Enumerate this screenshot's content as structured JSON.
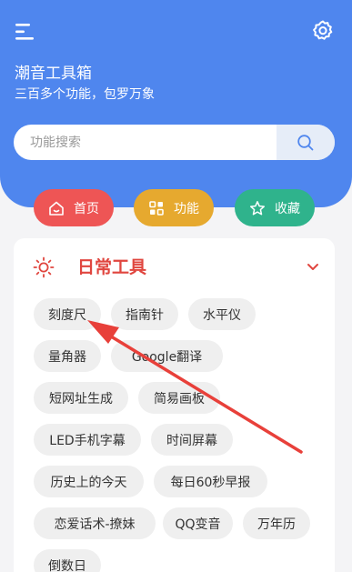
{
  "header": {
    "title": "潮音工具箱",
    "subtitle": "三百多个功能，包罗万象",
    "menu_icon": "menu-icon",
    "settings_icon": "gear-icon",
    "background": "#4f86ee"
  },
  "search": {
    "placeholder": "功能搜索",
    "button_icon": "search-icon"
  },
  "nav": {
    "home": {
      "label": "首页",
      "icon": "home-icon",
      "color": "#ee5555"
    },
    "functions": {
      "label": "功能",
      "icon": "grid-icon",
      "color": "#e6a92f"
    },
    "favorites": {
      "label": "收藏",
      "icon": "star-icon",
      "color": "#2fb38c"
    }
  },
  "category": {
    "title": "日常工具",
    "icon": "sun-icon",
    "expand_icon": "chevron-down-icon",
    "accent": "#e0463f",
    "tools": [
      "刻度尺",
      "指南针",
      "水平仪",
      "量角器",
      "Google翻译",
      "短网址生成",
      "简易画板",
      "LED手机字幕",
      "时间屏幕",
      "历史上的今天",
      "每日60秒早报",
      "恋爱话术-撩妹",
      "QQ变音",
      "万年历",
      "倒数日"
    ]
  },
  "annotation": {
    "color": "#e8403a"
  }
}
